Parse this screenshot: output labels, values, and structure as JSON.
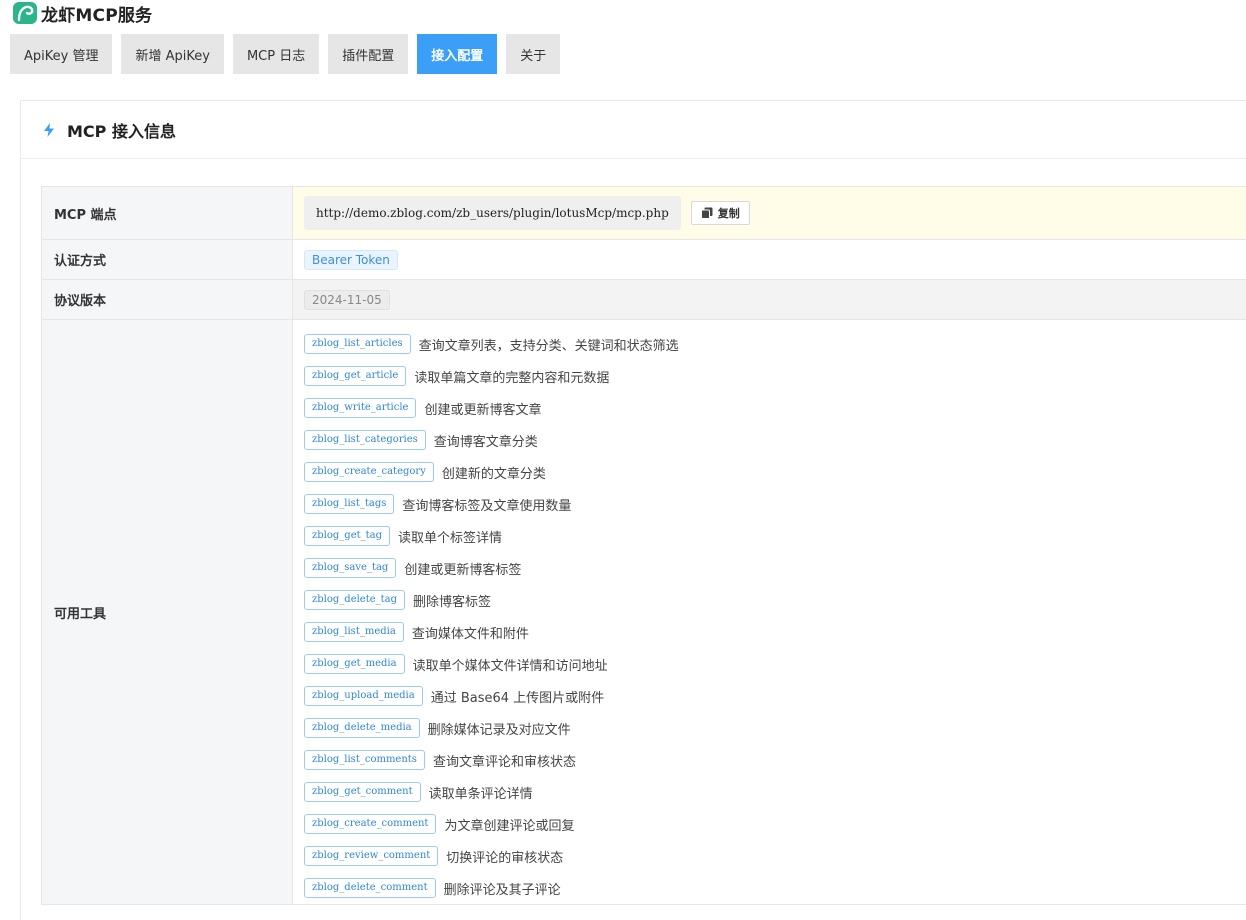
{
  "app": {
    "title": "龙虾MCP服务",
    "accent_color": "#3b9ff8",
    "logo_color": "#2bb58a"
  },
  "tabs": [
    {
      "label": "ApiKey 管理",
      "active": false
    },
    {
      "label": "新增 ApiKey",
      "active": false
    },
    {
      "label": "MCP 日志",
      "active": false
    },
    {
      "label": "插件配置",
      "active": false
    },
    {
      "label": "接入配置",
      "active": true
    },
    {
      "label": "关于",
      "active": false
    }
  ],
  "card": {
    "icon": "bolt-icon",
    "title": "MCP 接入信息"
  },
  "info": {
    "endpoint": {
      "label": "MCP 端点",
      "url": "http://demo.zblog.com/zb_users/plugin/lotusMcp/mcp.php",
      "copy_label": "复制"
    },
    "auth": {
      "label": "认证方式",
      "value": "Bearer Token"
    },
    "version": {
      "label": "协议版本",
      "value": "2024-11-05"
    },
    "tools": {
      "label": "可用工具",
      "items": [
        {
          "name": "zblog_list_articles",
          "desc": "查询文章列表，支持分类、关键词和状态筛选"
        },
        {
          "name": "zblog_get_article",
          "desc": "读取单篇文章的完整内容和元数据"
        },
        {
          "name": "zblog_write_article",
          "desc": "创建或更新博客文章"
        },
        {
          "name": "zblog_list_categories",
          "desc": "查询博客文章分类"
        },
        {
          "name": "zblog_create_category",
          "desc": "创建新的文章分类"
        },
        {
          "name": "zblog_list_tags",
          "desc": "查询博客标签及文章使用数量"
        },
        {
          "name": "zblog_get_tag",
          "desc": "读取单个标签详情"
        },
        {
          "name": "zblog_save_tag",
          "desc": "创建或更新博客标签"
        },
        {
          "name": "zblog_delete_tag",
          "desc": "删除博客标签"
        },
        {
          "name": "zblog_list_media",
          "desc": "查询媒体文件和附件"
        },
        {
          "name": "zblog_get_media",
          "desc": "读取单个媒体文件详情和访问地址"
        },
        {
          "name": "zblog_upload_media",
          "desc": "通过 Base64 上传图片或附件"
        },
        {
          "name": "zblog_delete_media",
          "desc": "删除媒体记录及对应文件"
        },
        {
          "name": "zblog_list_comments",
          "desc": "查询文章评论和审核状态"
        },
        {
          "name": "zblog_get_comment",
          "desc": "读取单条评论详情"
        },
        {
          "name": "zblog_create_comment",
          "desc": "为文章创建评论或回复"
        },
        {
          "name": "zblog_review_comment",
          "desc": "切换评论的审核状态"
        },
        {
          "name": "zblog_delete_comment",
          "desc": "删除评论及其子评论"
        }
      ]
    }
  }
}
